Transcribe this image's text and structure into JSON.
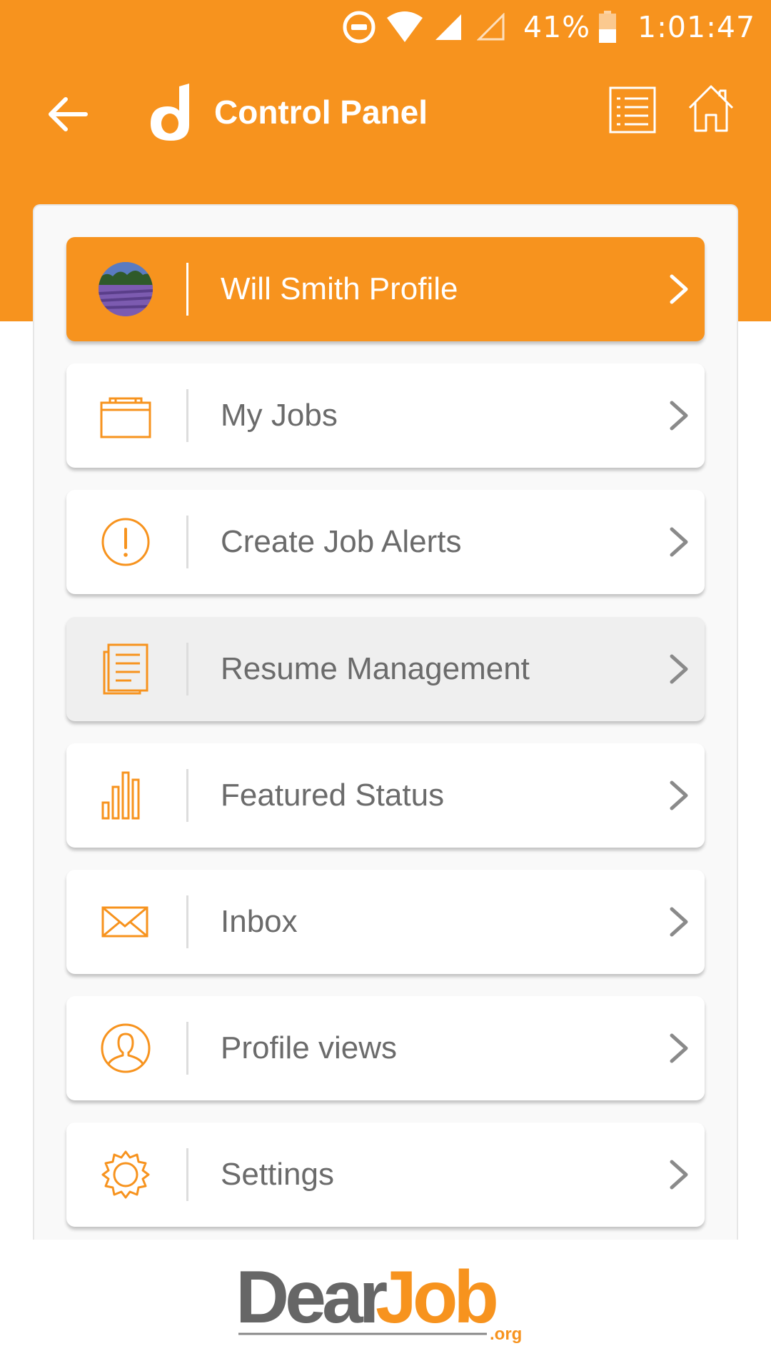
{
  "status_bar": {
    "battery_percent": "41%",
    "time": "1:01:47"
  },
  "app_bar": {
    "title": "Control Panel"
  },
  "menu": [
    {
      "label": "Will Smith Profile",
      "icon": "avatar",
      "state": "active"
    },
    {
      "label": "My Jobs",
      "icon": "briefcase-icon",
      "state": "normal"
    },
    {
      "label": "Create Job Alerts",
      "icon": "alert-icon",
      "state": "normal"
    },
    {
      "label": "Resume Management",
      "icon": "document-icon",
      "state": "pressed"
    },
    {
      "label": "Featured Status",
      "icon": "bar-chart-icon",
      "state": "normal"
    },
    {
      "label": "Inbox",
      "icon": "envelope-icon",
      "state": "normal"
    },
    {
      "label": "Profile views",
      "icon": "user-icon",
      "state": "normal"
    },
    {
      "label": "Settings",
      "icon": "gear-icon",
      "state": "normal"
    }
  ],
  "brand": {
    "name_dark": "Dear",
    "name_accent": "Job",
    "suffix": ".org"
  },
  "colors": {
    "accent": "#F7931E",
    "text": "#6b6b6b",
    "panel": "#f9f9f9",
    "brand_dark": "#666666"
  }
}
